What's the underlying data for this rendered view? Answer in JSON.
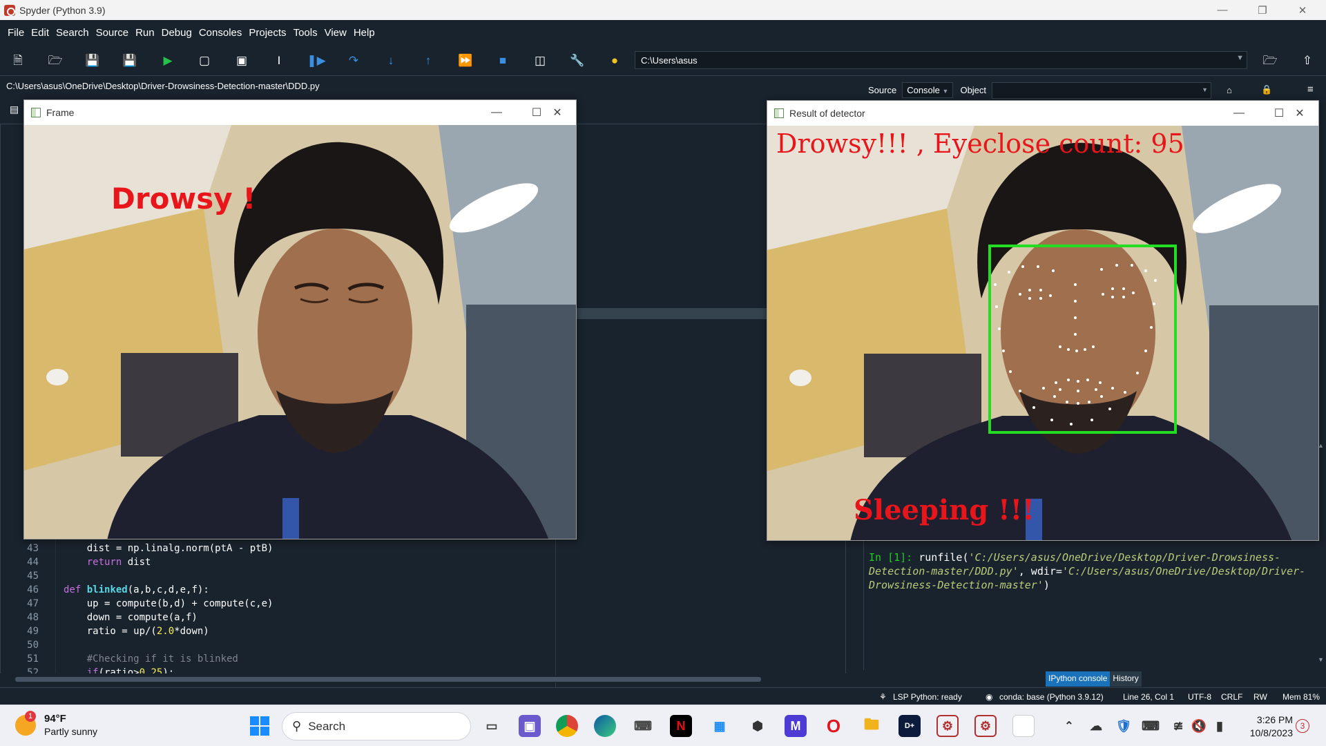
{
  "window": {
    "title": "Spyder (Python 3.9)"
  },
  "menu": [
    "File",
    "Edit",
    "Search",
    "Source",
    "Run",
    "Debug",
    "Consoles",
    "Projects",
    "Tools",
    "View",
    "Help"
  ],
  "toolbar": {
    "working_dir": "C:\\Users\\asus",
    "icons": [
      "new-file-icon",
      "open-folder-icon",
      "save-icon",
      "save-all-icon",
      "run-icon",
      "run-cell-icon",
      "run-cell-advance-icon",
      "run-selection-icon",
      "debug-icon",
      "step-over-icon",
      "step-into-icon",
      "step-out-icon",
      "continue-icon",
      "stop-icon",
      "maximize-pane-icon",
      "preferences-icon",
      "python-path-icon"
    ]
  },
  "editor": {
    "file_path": "C:\\Users\\asus\\OneDrive\\Desktop\\Driver-Drowsiness-Detection-master\\DDD.py",
    "line_numbers": [
      "43",
      "44",
      "45",
      "46",
      "47",
      "48",
      "49",
      "50",
      "51",
      "52"
    ]
  },
  "right_pane": {
    "source_label": "Source",
    "console_label": "Console",
    "object_label": "Object"
  },
  "console": {
    "prompt": "In [1]:",
    "command": "runfile(",
    "arg1": "'C:/Users/asus/OneDrive/Desktop/Driver-Drowsiness-Detection-master/DDD.py'",
    "sep": ", wdir=",
    "arg2": "'C:/Users/asus/OneDrive/Desktop/Driver-Drowsiness-Detection-master'",
    "close": ")",
    "tabs": [
      "IPython console",
      "History"
    ]
  },
  "frame_window": {
    "title": "Frame",
    "overlay_text": "Drowsy !"
  },
  "detector_window": {
    "title": "Result of detector",
    "overlay_top": "Drowsy!!! , Eyeclose count: 95",
    "overlay_bottom": "Sleeping !!!"
  },
  "statusbar": {
    "lsp": "LSP Python: ready",
    "conda": "conda: base (Python 3.9.12)",
    "cursor": "Line 26, Col 1",
    "encoding": "UTF-8",
    "eol": "CRLF",
    "perm": "RW",
    "mem": "Mem 81%"
  },
  "taskbar": {
    "weather_temp": "94°F",
    "weather_desc": "Partly sunny",
    "weather_badge": "1",
    "search_label": "Search",
    "time": "3:26 PM",
    "date": "10/8/2023",
    "notif_count": "3"
  },
  "colors": {
    "ide_bg": "#19232d",
    "drowsy_red": "#e8151b",
    "face_box": "#22dd22"
  }
}
